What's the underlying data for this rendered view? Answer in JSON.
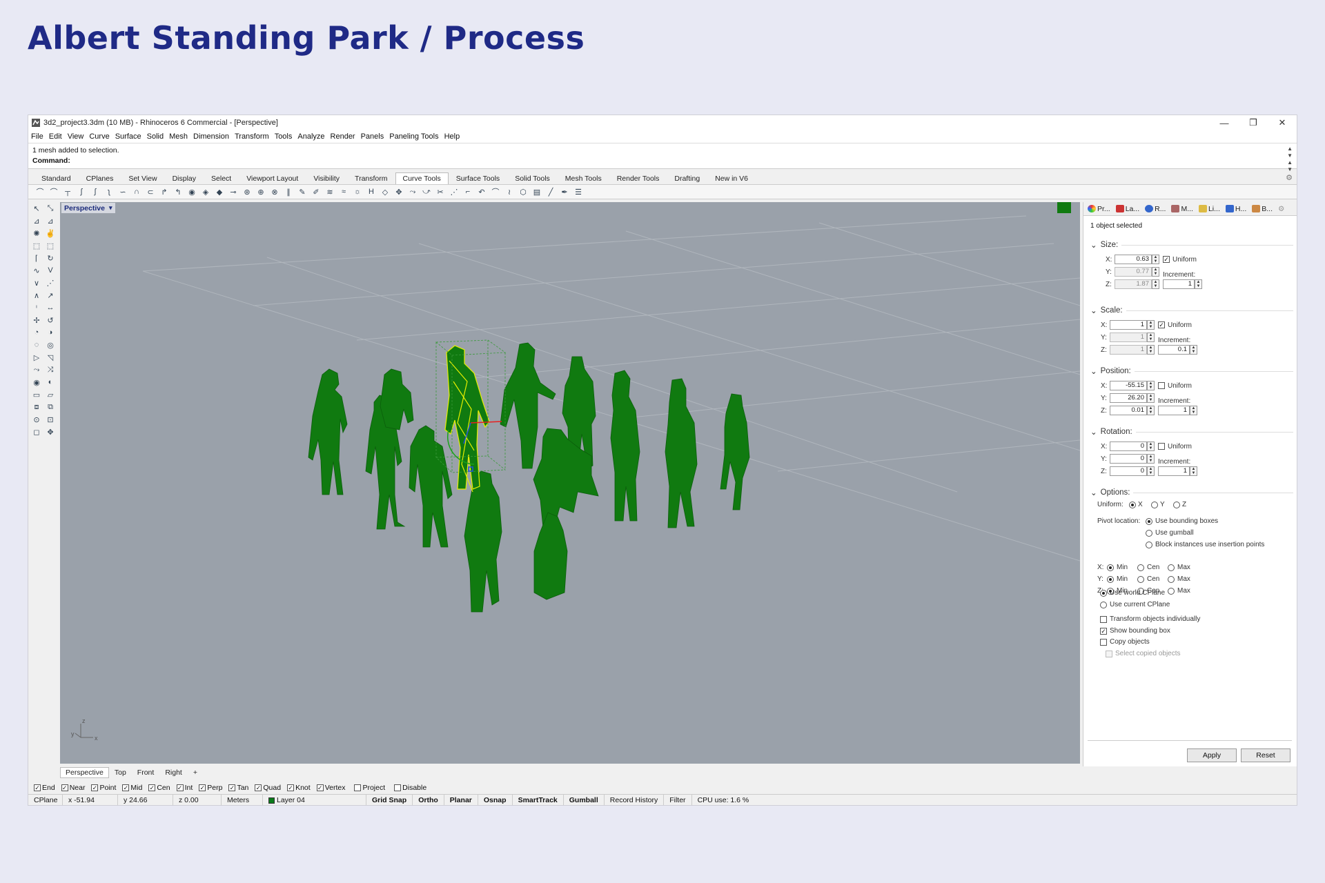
{
  "slide_title": "Albert Standing Park / Process",
  "window": {
    "title": "3d2_project3.3dm (10 MB) - Rhinoceros 6 Commercial - [Perspective]",
    "controls": [
      "—",
      "❐",
      "✕"
    ]
  },
  "menu": [
    "File",
    "Edit",
    "View",
    "Curve",
    "Surface",
    "Solid",
    "Mesh",
    "Dimension",
    "Transform",
    "Tools",
    "Analyze",
    "Render",
    "Panels",
    "Paneling Tools",
    "Help"
  ],
  "command": {
    "history": "1 mesh added to selection.",
    "prompt": "Command:"
  },
  "toolbar_tabs": [
    "Standard",
    "CPlanes",
    "Set View",
    "Display",
    "Select",
    "Viewport Layout",
    "Visibility",
    "Transform",
    "Curve Tools",
    "Surface Tools",
    "Solid Tools",
    "Mesh Tools",
    "Render Tools",
    "Drafting",
    "New in V6"
  ],
  "active_toolbar_tab": "Curve Tools",
  "viewport": {
    "label": "Perspective",
    "axis_labels": {
      "z": "z",
      "y": "y",
      "x": "x"
    },
    "colors": {
      "background": "#9aa1aa",
      "figure": "#107a10",
      "selected": "#e8f000"
    }
  },
  "view_tabs": [
    "Perspective",
    "Top",
    "Front",
    "Right",
    "+"
  ],
  "osnaps": [
    {
      "label": "End",
      "checked": true
    },
    {
      "label": "Near",
      "checked": true
    },
    {
      "label": "Point",
      "checked": true
    },
    {
      "label": "Mid",
      "checked": true
    },
    {
      "label": "Cen",
      "checked": true
    },
    {
      "label": "Int",
      "checked": true
    },
    {
      "label": "Perp",
      "checked": true
    },
    {
      "label": "Tan",
      "checked": true
    },
    {
      "label": "Quad",
      "checked": true
    },
    {
      "label": "Knot",
      "checked": true
    },
    {
      "label": "Vertex",
      "checked": true
    },
    {
      "label": "Project",
      "checked": false
    },
    {
      "label": "Disable",
      "checked": false
    }
  ],
  "status": {
    "cplane": "CPlane",
    "x": "x -51.94",
    "y": "y 24.66",
    "z": "z 0.00",
    "units": "Meters",
    "layer": "Layer 04",
    "toggles": [
      "Grid Snap",
      "Ortho",
      "Planar",
      "Osnap",
      "SmartTrack",
      "Gumball"
    ],
    "record_history": "Record History",
    "filter": "Filter",
    "cpu": "CPU use: 1.6 %"
  },
  "panel": {
    "tabs": [
      "Pr...",
      "La...",
      "R...",
      "M...",
      "Li...",
      "H...",
      "B..."
    ],
    "selection_info": "1 object selected",
    "size": {
      "title": "Size:",
      "x": "0.63",
      "y": "0.77",
      "z": "1.87",
      "uniform_label": "Uniform",
      "uniform": true,
      "increment_label": "Increment:",
      "increment": "1"
    },
    "scale": {
      "title": "Scale:",
      "x": "1",
      "y": "1",
      "z": "1",
      "uniform_label": "Uniform",
      "uniform": true,
      "increment_label": "Increment:",
      "increment": "0.1"
    },
    "position": {
      "title": "Position:",
      "x": "-55.15",
      "y": "26.20",
      "z": "0.01",
      "uniform_label": "Uniform",
      "uniform": false,
      "increment_label": "Increment:",
      "increment": "1"
    },
    "rotation": {
      "title": "Rotation:",
      "x": "0",
      "y": "0",
      "z": "0",
      "uniform_label": "Uniform",
      "uniform": false,
      "increment_label": "Increment:",
      "increment": "1"
    },
    "options": {
      "title": "Options:",
      "uniform_label": "Uniform:",
      "uniform_axes": [
        "X",
        "Y",
        "Z"
      ],
      "uniform_selected": "X",
      "pivot_label": "Pivot location:",
      "pivot_options": [
        "Use bounding boxes",
        "Use gumball",
        "Block instances use insertion points"
      ],
      "pivot_selected": "Use bounding boxes",
      "axis_rows": [
        "X:",
        "Y:",
        "Z:"
      ],
      "axis_choices": [
        "Min",
        "Cen",
        "Max"
      ],
      "axis_selected": "Min",
      "cplane_options": [
        "Use world CPlane",
        "Use current CPlane"
      ],
      "cplane_selected": "Use world CPlane",
      "checks": [
        {
          "label": "Transform objects individually",
          "checked": false,
          "enabled": true
        },
        {
          "label": "Show bounding box",
          "checked": true,
          "enabled": true
        },
        {
          "label": "Copy objects",
          "checked": false,
          "enabled": true
        },
        {
          "label": "Select copied objects",
          "checked": false,
          "enabled": false
        }
      ]
    },
    "apply": "Apply",
    "reset": "Reset"
  }
}
